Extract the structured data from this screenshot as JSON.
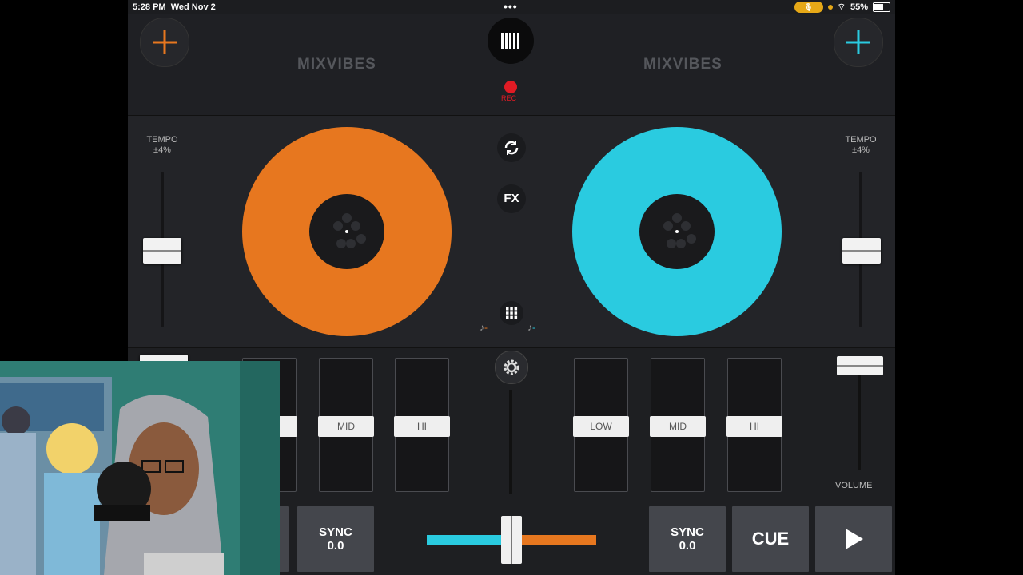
{
  "status_bar": {
    "time": "5:28 PM",
    "date": "Wed Nov 2",
    "battery": "55%"
  },
  "header": {
    "logo_left": "MIXVIBES",
    "logo_right": "MIXVIBES",
    "rec_label": "REC"
  },
  "colors": {
    "deck_a": "#e7771f",
    "deck_b": "#2acbe0",
    "rec": "#e01b24"
  },
  "deck_a": {
    "tempo_label": "TEMPO",
    "tempo_range": "±4%"
  },
  "deck_b": {
    "tempo_label": "TEMPO",
    "tempo_range": "±4%"
  },
  "center": {
    "fx_label": "FX"
  },
  "eq": {
    "left": [
      "MID",
      "HI"
    ],
    "right": [
      "LOW",
      "MID",
      "HI"
    ]
  },
  "volume_label": "VOLUME",
  "transport": {
    "sync_left_label": "SYNC",
    "sync_left_value": "0.0",
    "sync_right_label": "SYNC",
    "sync_right_value": "0.0",
    "cue_label": "CUE"
  },
  "icons": [
    "plus-icon",
    "menu-bars-icon",
    "loop-icon",
    "grid-icon",
    "gear-icon",
    "play-icon",
    "music-note-icon"
  ]
}
